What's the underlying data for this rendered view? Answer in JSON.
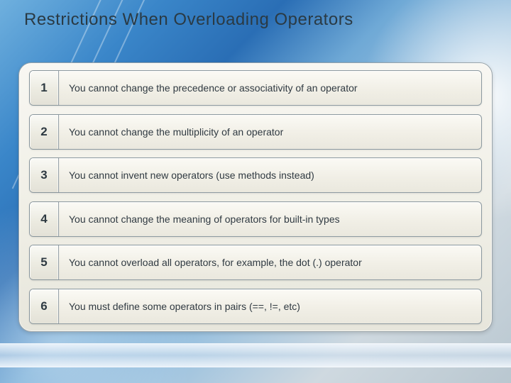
{
  "title": "Restrictions When Overloading Operators",
  "items": [
    {
      "n": "1",
      "text": "You cannot change the precedence or associativity of an operator"
    },
    {
      "n": "2",
      "text": "You cannot change the multiplicity of an operator"
    },
    {
      "n": "3",
      "text": "You cannot invent new operators (use methods instead)"
    },
    {
      "n": "4",
      "text": "You cannot change the meaning of operators for built-in types"
    },
    {
      "n": "5",
      "text": "You cannot overload all operators, for example, the dot (.) operator"
    },
    {
      "n": "6",
      "text": "You must define some operators in pairs (==, !=, etc)"
    }
  ]
}
